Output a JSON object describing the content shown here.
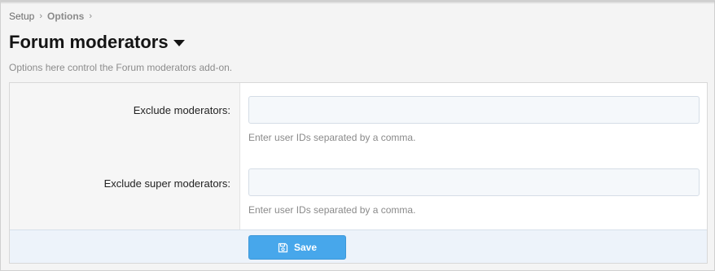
{
  "breadcrumb": {
    "items": [
      "Setup",
      "Options"
    ],
    "separator": "›"
  },
  "header": {
    "title": "Forum moderators",
    "description": "Options here control the Forum moderators add-on."
  },
  "form": {
    "fields": [
      {
        "label": "Exclude moderators:",
        "value": "",
        "hint": "Enter user IDs separated by a comma."
      },
      {
        "label": "Exclude super moderators:",
        "value": "",
        "hint": "Enter user IDs separated by a comma."
      }
    ],
    "save_label": "Save"
  },
  "icons": {
    "title_caret": "caret-down-icon",
    "save": "floppy-disk-icon"
  },
  "colors": {
    "accent": "#47a7eb",
    "footer_bg": "#edf3fa",
    "input_bg": "#f5f8fb"
  }
}
